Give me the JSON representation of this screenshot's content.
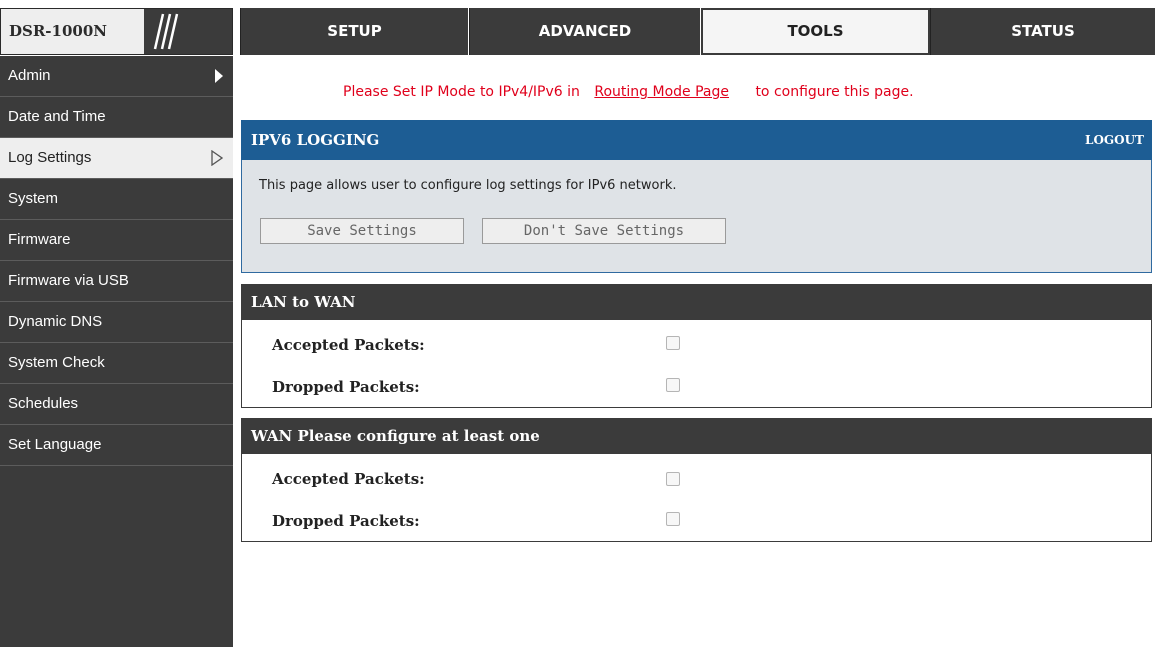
{
  "header": {
    "model": "DSR-1000N",
    "tabs": [
      {
        "label": "SETUP"
      },
      {
        "label": "ADVANCED"
      },
      {
        "label": "TOOLS"
      },
      {
        "label": "STATUS"
      }
    ],
    "active_tab": "TOOLS"
  },
  "sidebar": {
    "items": [
      {
        "label": "Admin"
      },
      {
        "label": "Date and Time"
      },
      {
        "label": "Log Settings"
      },
      {
        "label": "System"
      },
      {
        "label": "Firmware"
      },
      {
        "label": "Firmware via USB"
      },
      {
        "label": "Dynamic DNS"
      },
      {
        "label": "System Check"
      },
      {
        "label": "Schedules"
      },
      {
        "label": "Set Language"
      }
    ],
    "active_item": "Log Settings"
  },
  "notice": {
    "prefix": "Please Set IP Mode to IPv4/IPv6 in",
    "link": "Routing Mode Page",
    "suffix": "to configure this page."
  },
  "panel": {
    "title": "IPV6 LOGGING",
    "logout": "LOGOUT",
    "description": "This page allows user to configure log settings for IPv6 network.",
    "save_label": "Save Settings",
    "dont_save_label": "Don't Save Settings"
  },
  "sections": [
    {
      "title": "LAN to WAN",
      "rows": [
        {
          "label": "Accepted Packets:",
          "checked": false
        },
        {
          "label": "Dropped Packets:",
          "checked": false
        }
      ]
    },
    {
      "title": "WAN Please configure at least one",
      "rows": [
        {
          "label": "Accepted Packets:",
          "checked": false
        },
        {
          "label": "Dropped Packets:",
          "checked": false
        }
      ]
    }
  ],
  "colors": {
    "accent_blue": "#1d5d94",
    "dark_gray": "#3b3b3b",
    "notice_red": "#e0001b",
    "panel_body": "#dfe3e7"
  }
}
